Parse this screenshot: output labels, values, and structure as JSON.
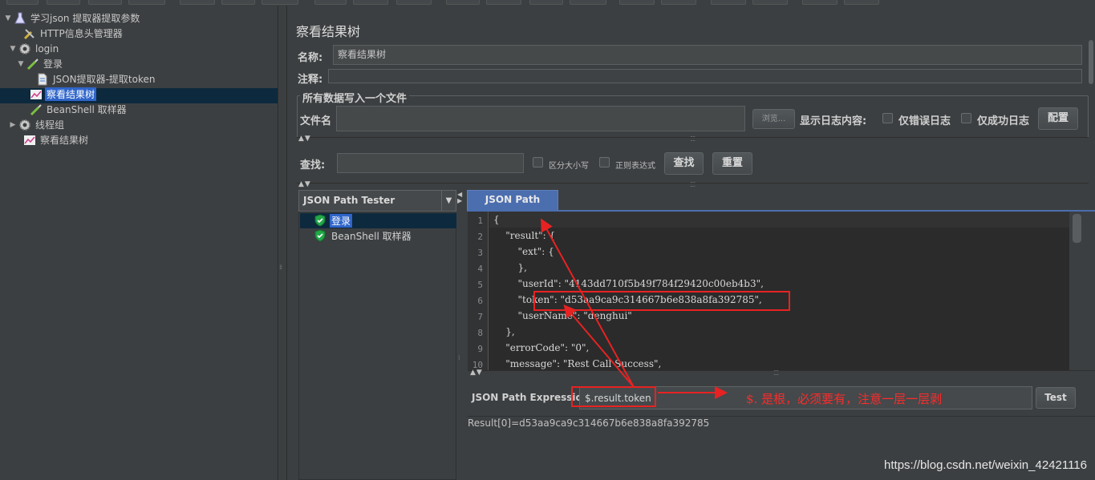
{
  "tree": {
    "items": [
      {
        "label": "学习json 提取器提取参数",
        "toggle": "▼",
        "icon": "flask-icon"
      },
      {
        "label": "HTTP信息头管理器",
        "toggle": "",
        "icon": "wrench-icon"
      },
      {
        "label": "login",
        "toggle": "▼",
        "icon": "gear-icon"
      },
      {
        "label": "登录",
        "toggle": "▼",
        "icon": "pipette-icon"
      },
      {
        "label": "JSON提取器-提取token",
        "toggle": "",
        "icon": "document-icon"
      },
      {
        "label": "察看结果树",
        "toggle": "",
        "icon": "chart-icon"
      },
      {
        "label": "BeanShell 取样器",
        "toggle": "",
        "icon": "pipette-icon"
      },
      {
        "label": "线程组",
        "toggle": "▶",
        "icon": "gear-icon"
      },
      {
        "label": "察看结果树",
        "toggle": "",
        "icon": "chart-icon"
      }
    ]
  },
  "main": {
    "title": "察看结果树",
    "name_label": "名称:",
    "name_value": "察看结果树",
    "comment_label": "注释:",
    "comment_value": "",
    "file_section_legend": "所有数据写入一个文件",
    "file_label": "文件名",
    "file_value": "",
    "browse_label": "浏览...",
    "log_display_label": "显示日志内容:",
    "errors_only_label": "仅错误日志",
    "success_only_label": "仅成功日志",
    "configure_label": "配置",
    "search_label": "查找:",
    "search_value": "",
    "case_sensitive_label": "区分大小写",
    "regex_label": "正则表达式",
    "find_button": "查找",
    "reset_button": "重置"
  },
  "renderer": {
    "selected": "JSON Path Tester",
    "results": [
      {
        "label": "登录",
        "status": "success"
      },
      {
        "label": "BeanShell 取样器",
        "status": "success"
      }
    ]
  },
  "tester": {
    "tab_label": "JSON Path Tester",
    "lines": [
      {
        "n": "1",
        "text": "{"
      },
      {
        "n": "2",
        "text": "    \"result\": {"
      },
      {
        "n": "3",
        "text": "        \"ext\": {"
      },
      {
        "n": "4",
        "text": "        },"
      },
      {
        "n": "5",
        "text": "        \"userId\": \"4143dd710f5b49f784f29420c00eb4b3\","
      },
      {
        "n": "6",
        "text": "        \"token\": \"d53aa9ca9c314667b6e838a8fa392785\","
      },
      {
        "n": "7",
        "text": "        \"userName\": \"denghui\""
      },
      {
        "n": "8",
        "text": "    },"
      },
      {
        "n": "9",
        "text": "    \"errorCode\": \"0\","
      },
      {
        "n": "10",
        "text": "    \"message\": \"Rest Call Success\","
      }
    ],
    "expression_label": "JSON Path Expression",
    "expression_value": "$.result.token",
    "test_button": "Test",
    "result": "Result[0]=d53aa9ca9c314667b6e838a8fa392785"
  },
  "annotation": {
    "note": "$.    是根，必须要有，注意一层一层剥",
    "color": "#e82222"
  },
  "watermark": "https://blog.csdn.net/weixin_42421116"
}
